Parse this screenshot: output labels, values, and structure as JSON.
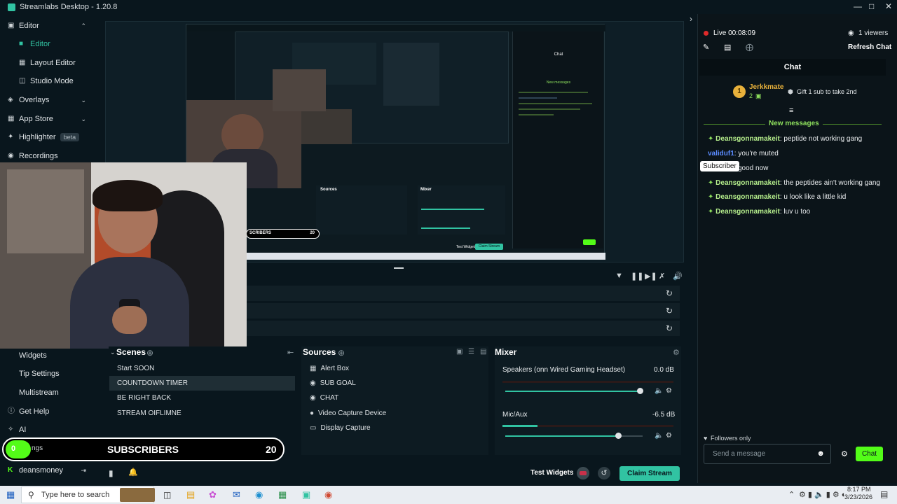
{
  "app": {
    "title": "Streamlabs Desktop - 1.20.8"
  },
  "nav": {
    "editor_group": "Editor",
    "editor": "Editor",
    "layout_editor": "Layout Editor",
    "studio_mode": "Studio Mode",
    "overlays": "Overlays",
    "app_store": "App Store",
    "highlighter": "Highlighter",
    "highlighter_badge": "beta",
    "recordings": "Recordings",
    "widgets": "Widgets",
    "tip_settings": "Tip Settings",
    "multistream": "Multistream",
    "get_help": "Get Help",
    "ai": "AI",
    "settings_partial": "ngs",
    "account": "deansmoney"
  },
  "scenes": {
    "title": "Scenes",
    "items": [
      "Start SOON",
      "COUNTDOWN TIMER",
      "BE RIGHT BACK",
      "STREAM OIFLIMNE"
    ]
  },
  "sources": {
    "title": "Sources",
    "items": [
      "Alert Box",
      "SUB GOAL",
      "CHAT",
      "Video Capture Device",
      "Display Capture"
    ]
  },
  "mixer": {
    "title": "Mixer",
    "channels": [
      {
        "name": "Speakers (onn Wired Gaming Headset)",
        "db": "0.0 dB",
        "volume": 0.98
      },
      {
        "name": "Mic/Aux",
        "db": "-6.5 dB",
        "volume": 0.82
      }
    ]
  },
  "subscribers": {
    "label": "SUBSCRIBERS",
    "count": "20",
    "circle": "0"
  },
  "footer": {
    "test_widgets": "Test Widgets",
    "claim_stream": "Claim Stream"
  },
  "chat": {
    "live": "Live 00:08:09",
    "viewers": "1 viewers",
    "refresh": "Refresh Chat",
    "header": "Chat",
    "top_user": "Jerkkmate",
    "top_user_count": "2",
    "gift_text": "Gift 1 sub to take 2nd",
    "new_messages": "New messages",
    "messages": [
      {
        "user": "Deansgonnamakeit",
        "text": ": peptide not working gang"
      },
      {
        "user": "validuf1",
        "text": ": you're muted"
      },
      {
        "user": "",
        "text": "good now"
      },
      {
        "user": "Deansgonnamakeit",
        "text": ": the peptides ain't working gang"
      },
      {
        "user": "Deansgonnamakeit",
        "text": ": u look like a little kid"
      },
      {
        "user": "Deansgonnamakeit",
        "text": ": luv u too"
      }
    ],
    "subscriber_tooltip": "Subscriber",
    "followers_only": "Followers only",
    "input_placeholder": "Send a message",
    "chat_button": "Chat"
  },
  "taskbar": {
    "search_placeholder": "Type here to search",
    "time": "8:17 PM",
    "date": "3/23/2026"
  },
  "preview_inner": {
    "subscribers_label": "SCRIBERS",
    "subscribers_count": "20",
    "sources_title": "Sources",
    "mixer_title": "Mixer",
    "test_widgets": "Test Widgets",
    "claim_stream": "Claim Stream",
    "chat_title": "Chat",
    "new_messages": "New messages"
  }
}
